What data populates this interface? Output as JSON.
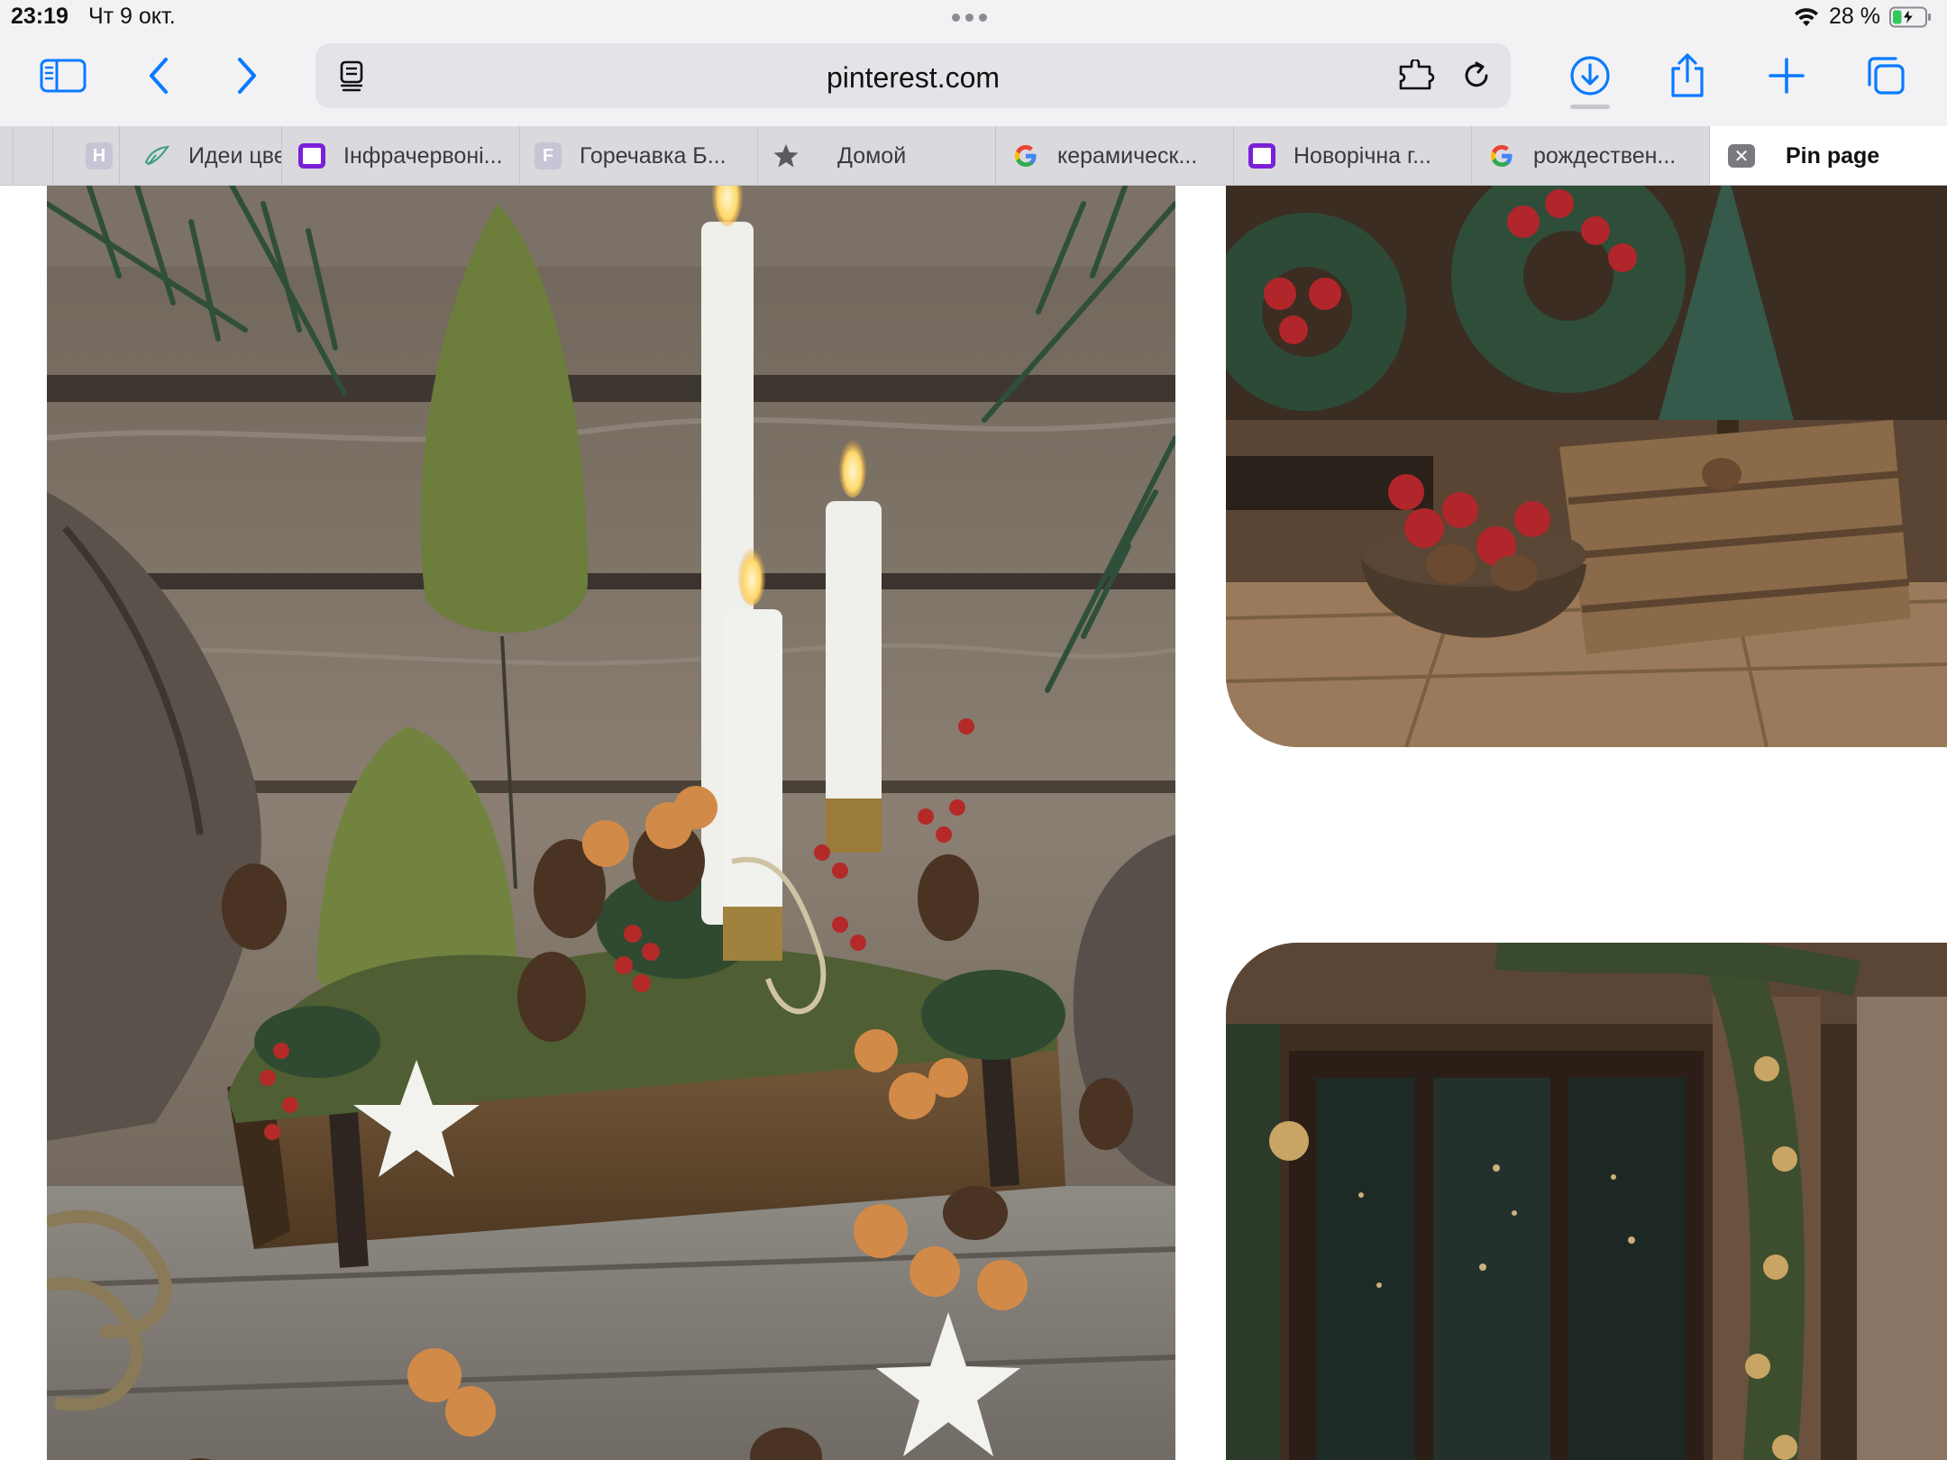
{
  "status_bar": {
    "time": "23:19",
    "date": "Чт 9 окт.",
    "battery_percent": "28 %",
    "battery_level": 0.28,
    "charging": true
  },
  "toolbar": {
    "url": "pinterest.com",
    "accent_color": "#0a7aff",
    "buttons": [
      "sidebar-icon",
      "back-icon",
      "forward-icon",
      "download-icon",
      "share-icon",
      "plus-icon",
      "tabs-overview-icon"
    ]
  },
  "tabs": [
    {
      "favicon": "letter",
      "favicon_text": "H",
      "label": ""
    },
    {
      "favicon": "leaf-icon",
      "favicon_text": "",
      "label": "Идеи цве"
    },
    {
      "favicon": "purple-square-icon",
      "favicon_text": "",
      "label": "Інфрачервоні..."
    },
    {
      "favicon": "letter",
      "favicon_text": "F",
      "label": "Горечавка Б..."
    },
    {
      "favicon": "star-icon",
      "favicon_text": "",
      "label": "Домой"
    },
    {
      "favicon": "google-icon",
      "favicon_text": "",
      "label": "керамическ..."
    },
    {
      "favicon": "purple-square-icon",
      "favicon_text": "",
      "label": "Новорічна г..."
    },
    {
      "favicon": "google-icon",
      "favicon_text": "",
      "label": "рождествен..."
    },
    {
      "favicon": "close-icon",
      "favicon_text": "✕",
      "label": "Pin page",
      "active": true
    }
  ],
  "pins": [
    {
      "name": "rustic-candle-centerpiece"
    },
    {
      "name": "porch-wreaths-and-crate"
    },
    {
      "name": "cabin-window-garland"
    }
  ]
}
